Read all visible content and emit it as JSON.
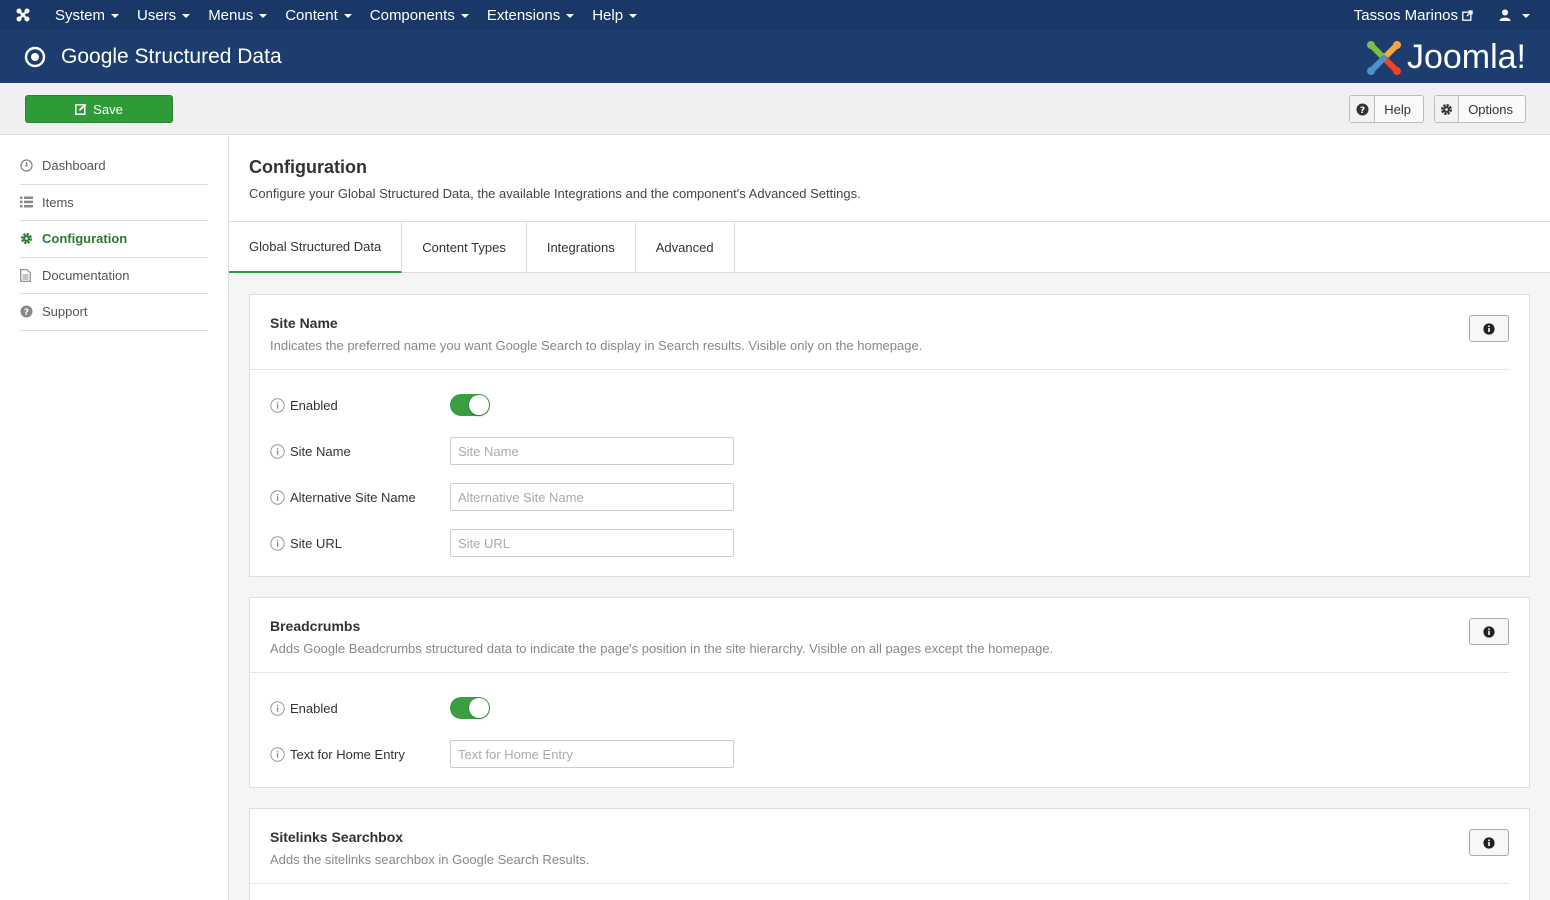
{
  "topnav": {
    "menus": [
      "System",
      "Users",
      "Menus",
      "Content",
      "Components",
      "Extensions",
      "Help"
    ],
    "user_name": "Tassos Marinos"
  },
  "header": {
    "title": "Google Structured Data",
    "brand": "Joomla!"
  },
  "toolbar": {
    "save_label": "Save",
    "help_label": "Help",
    "options_label": "Options"
  },
  "sidebar": {
    "items": [
      {
        "label": "Dashboard",
        "icon": "dashboard-icon"
      },
      {
        "label": "Items",
        "icon": "list-icon"
      },
      {
        "label": "Configuration",
        "icon": "gear-icon",
        "active": true
      },
      {
        "label": "Documentation",
        "icon": "document-icon"
      },
      {
        "label": "Support",
        "icon": "question-icon"
      }
    ]
  },
  "main": {
    "title": "Configuration",
    "description": "Configure your Global Structured Data, the available Integrations and the component's Advanced Settings.",
    "tabs": [
      {
        "label": "Global Structured Data",
        "active": true
      },
      {
        "label": "Content Types"
      },
      {
        "label": "Integrations"
      },
      {
        "label": "Advanced"
      }
    ]
  },
  "panels": {
    "site_name": {
      "title": "Site Name",
      "description": "Indicates the preferred name you want Google Search to display in Search results. Visible only on the homepage.",
      "enabled_label": "Enabled",
      "enabled": true,
      "site_name_label": "Site Name",
      "site_name_placeholder": "Site Name",
      "alt_name_label": "Alternative Site Name",
      "alt_name_placeholder": "Alternative Site Name",
      "site_url_label": "Site URL",
      "site_url_placeholder": "Site URL"
    },
    "breadcrumbs": {
      "title": "Breadcrumbs",
      "description": "Adds Google Beadcrumbs structured data to indicate the page's position in the site hierarchy. Visible on all pages except the homepage.",
      "enabled_label": "Enabled",
      "enabled": true,
      "home_label": "Text for Home Entry",
      "home_placeholder": "Text for Home Entry"
    },
    "sitelinks": {
      "title": "Sitelinks Searchbox",
      "description": "Adds the sitelinks searchbox in Google Search Results."
    }
  },
  "colors": {
    "nav_bg": "#1a3867",
    "header_bg": "#1c3d6e",
    "save_green": "#2f9a38",
    "active_green": "#2a7a2f"
  }
}
